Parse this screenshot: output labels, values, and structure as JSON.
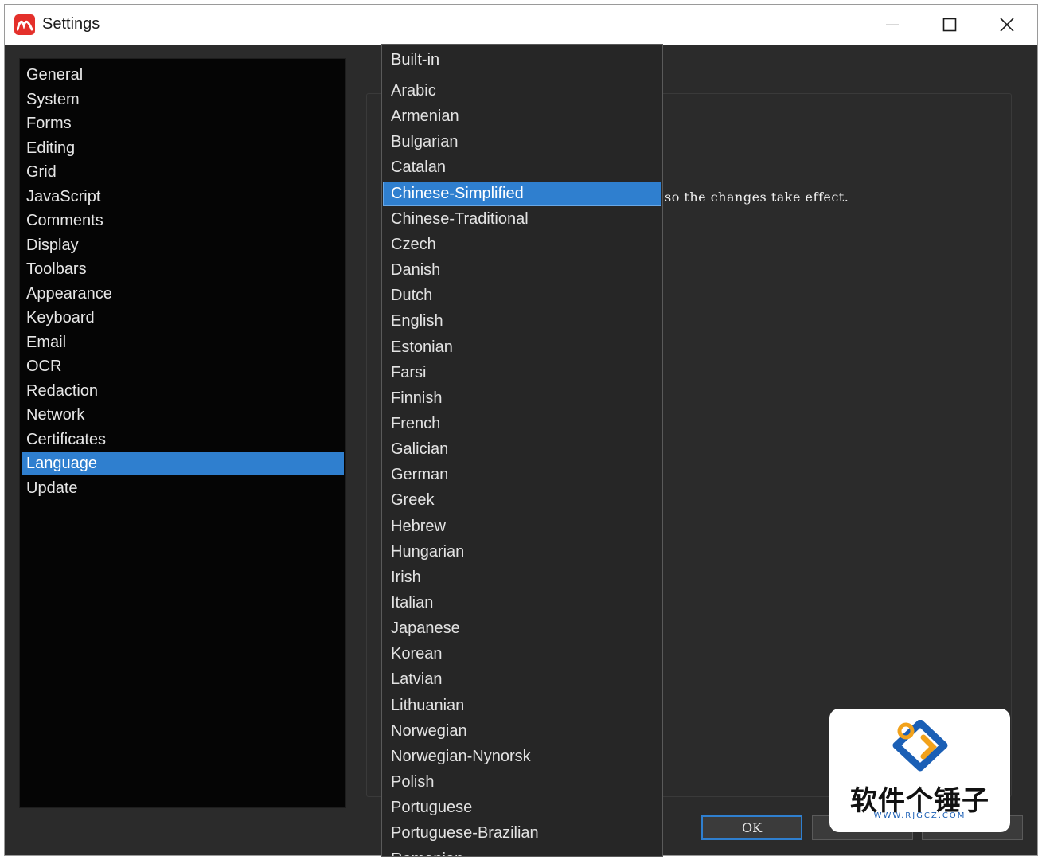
{
  "window": {
    "title": "Settings",
    "accent_color": "#2f7fcf",
    "app_icon_color": "#e4302b"
  },
  "nav": {
    "items": [
      {
        "label": "General"
      },
      {
        "label": "System"
      },
      {
        "label": "Forms"
      },
      {
        "label": "Editing"
      },
      {
        "label": "Grid"
      },
      {
        "label": "JavaScript"
      },
      {
        "label": "Comments"
      },
      {
        "label": "Display"
      },
      {
        "label": "Toolbars"
      },
      {
        "label": "Appearance"
      },
      {
        "label": "Keyboard"
      },
      {
        "label": "Email"
      },
      {
        "label": "OCR"
      },
      {
        "label": "Redaction"
      },
      {
        "label": "Network"
      },
      {
        "label": "Certificates"
      },
      {
        "label": "Language"
      },
      {
        "label": "Update"
      }
    ],
    "selected": "Language"
  },
  "content": {
    "info_text": "so the changes take effect."
  },
  "dropdown": {
    "header": "Built-in",
    "selected": "Chinese-Simplified",
    "items": [
      "Arabic",
      "Armenian",
      "Bulgarian",
      "Catalan",
      "Chinese-Simplified",
      "Chinese-Traditional",
      "Czech",
      "Danish",
      "Dutch",
      "English",
      "Estonian",
      "Farsi",
      "Finnish",
      "French",
      "Galician",
      "German",
      "Greek",
      "Hebrew",
      "Hungarian",
      "Irish",
      "Italian",
      "Japanese",
      "Korean",
      "Latvian",
      "Lithuanian",
      "Norwegian",
      "Norwegian-Nynorsk",
      "Polish",
      "Portuguese",
      "Portuguese-Brazilian",
      "Romanian"
    ]
  },
  "buttons": {
    "ok_label": "OK",
    "second_label": "",
    "third_label": ""
  },
  "watermark": {
    "name": "软件个锤子",
    "url": "WWW.RJGCZ.COM",
    "logo_icon": "rjgcz-logo"
  }
}
